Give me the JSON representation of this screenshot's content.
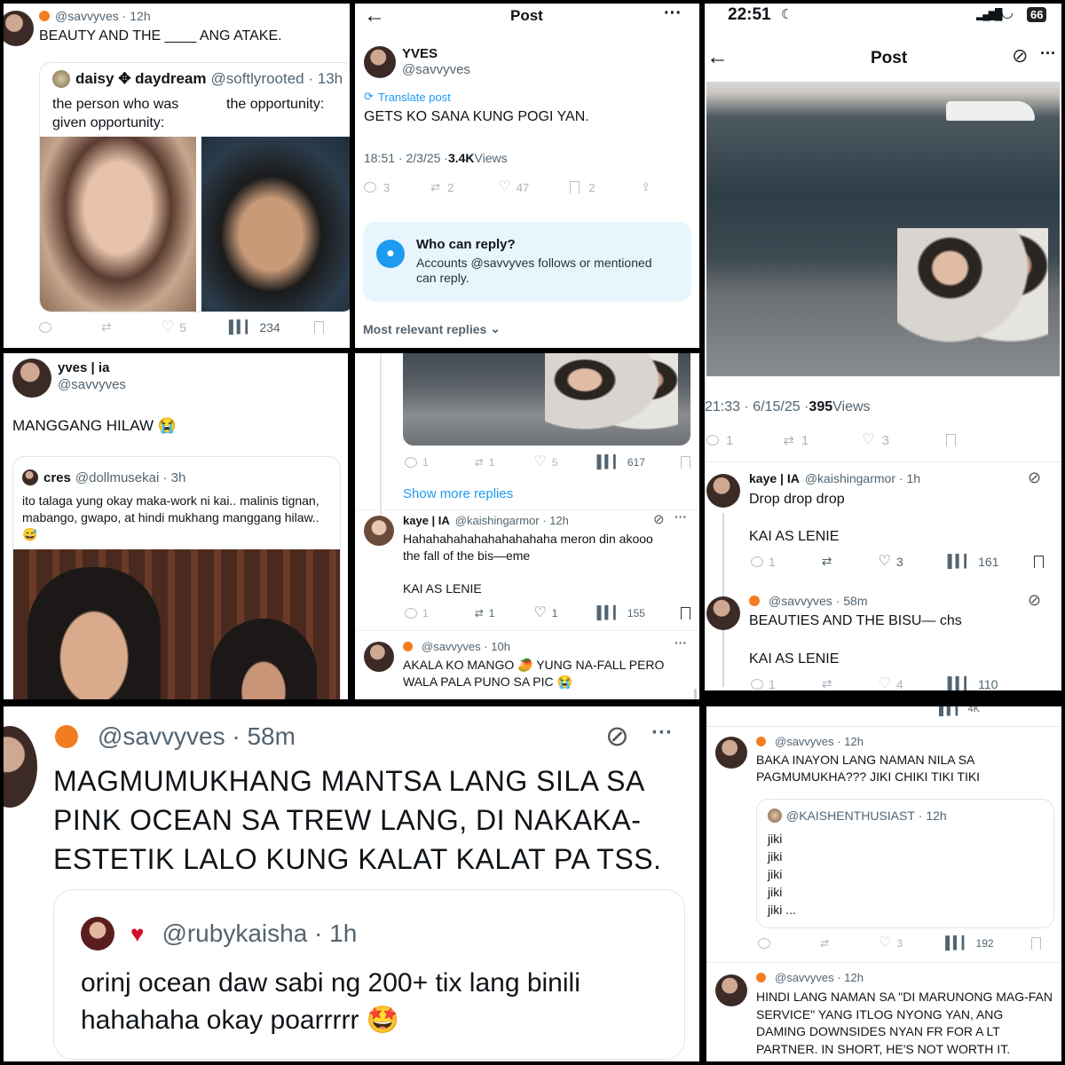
{
  "p1": {
    "handle": "@savvyves",
    "time": "12h",
    "text": "BEAUTY AND THE ____ ANG ATAKE.",
    "quote": {
      "name": "daisy ✥ daydream",
      "handle": "@softlyrooted",
      "time": "13h",
      "left_text": "the person who was given opportunity:",
      "right_text": "the opportunity:"
    },
    "likes": "5",
    "views": "234"
  },
  "p2": {
    "header_title": "Post",
    "name": "YVES",
    "handle": "@savvyves",
    "translate": "Translate post",
    "text": "GETS KO SANA KUNG POGI YAN.",
    "meta_time": "18:51 · 2/3/25 · ",
    "views_count": "3.4K",
    "views_label": " Views",
    "replies": "3",
    "reposts": "2",
    "likes": "47",
    "bookmarks": "2",
    "who_title": "Who can reply?",
    "who_text": "Accounts @savvyves follows or mentioned can reply.",
    "relevant": "Most relevant replies"
  },
  "p3": {
    "status_time": "22:51",
    "battery": "66",
    "header_title": "Post",
    "meta_time": "21:33 · 6/15/25 · ",
    "views_count": "395",
    "views_label": " Views",
    "replies": "1",
    "reposts": "1",
    "likes": "3",
    "r1": {
      "name": "kaye | IA",
      "handle": "@kaishingarmor",
      "time": "1h",
      "line1": "Drop drop drop",
      "line2": "KAI AS LENIE",
      "replies": "1",
      "likes": "3",
      "views": "161"
    },
    "r2": {
      "handle": "@savvyves",
      "time": "58m",
      "line1": "BEAUTIES AND THE BISU— chs",
      "line2": "KAI AS LENIE",
      "replies": "1",
      "likes": "4",
      "views": "110"
    }
  },
  "p4": {
    "name": "yves | ia",
    "handle": "@savvyves",
    "text": "MANGGANG HILAW 😭",
    "quote": {
      "name": "cres",
      "handle": "@dollmusekai",
      "time": "3h",
      "text": "ito talaga yung okay maka-work ni kai.. malinis tignan, mabango, gwapo, at hindi mukhang manggang hilaw.. 😅"
    }
  },
  "p5": {
    "top": {
      "replies": "1",
      "reposts": "1",
      "likes": "5",
      "views": "617"
    },
    "show_more": "Show more replies",
    "r1": {
      "name": "kaye | IA",
      "handle": "@kaishingarmor",
      "time": "12h",
      "line1": "Hahahahahahahahahahaha meron din akooo the fall of the bis—eme",
      "line2": "KAI AS LENIE",
      "replies": "1",
      "reposts": "1",
      "likes": "1",
      "views": "155"
    },
    "r2": {
      "handle": "@savvyves",
      "time": "10h",
      "text": "AKALA KO MANGO 🥭 YUNG NA-FALL PERO WALA PALA PUNO SA PIC 😭"
    }
  },
  "p6": {
    "handle": "@savvyves",
    "time": "58m",
    "text": "MAGMUMUKHANG MANTSA LANG SILA SA PINK OCEAN SA TREW LANG, DI NAKAKA-ESTETIK LALO KUNG KALAT KALAT PA TSS.",
    "quote": {
      "handle": "@rubykaisha",
      "time": "1h",
      "text": "orinj ocean daw sabi ng 200+ tix lang binili hahahaha okay poarrrrr 🤩"
    }
  },
  "p7": {
    "top_views": "4K",
    "t1": {
      "handle": "@savvyves",
      "time": "12h",
      "text": "BAKA INAYON LANG NAMAN NILA SA PAGMUMUKHA??? JIKI CHIKI TIKI TIKI",
      "quote_handle": "@KAISHENTHUSIAST",
      "quote_time": "12h",
      "quote_lines": [
        "jiki",
        "jiki",
        "jiki",
        "jiki",
        "jiki ..."
      ],
      "likes": "3",
      "views": "192"
    },
    "t2": {
      "handle": "@savvyves",
      "time": "12h",
      "text": "HINDI LANG NAMAN SA \"DI MARUNONG MAG-FAN SERVICE\" YANG ITLOG NYONG YAN, ANG DAMING DOWNSIDES NYAN FR FOR  A LT PARTNER. IN SHORT, HE'S NOT WORTH IT."
    }
  },
  "colors": {
    "accent": "#1d9bf0",
    "text": "#0f1419",
    "muted": "#536471",
    "grid": "#000000"
  }
}
